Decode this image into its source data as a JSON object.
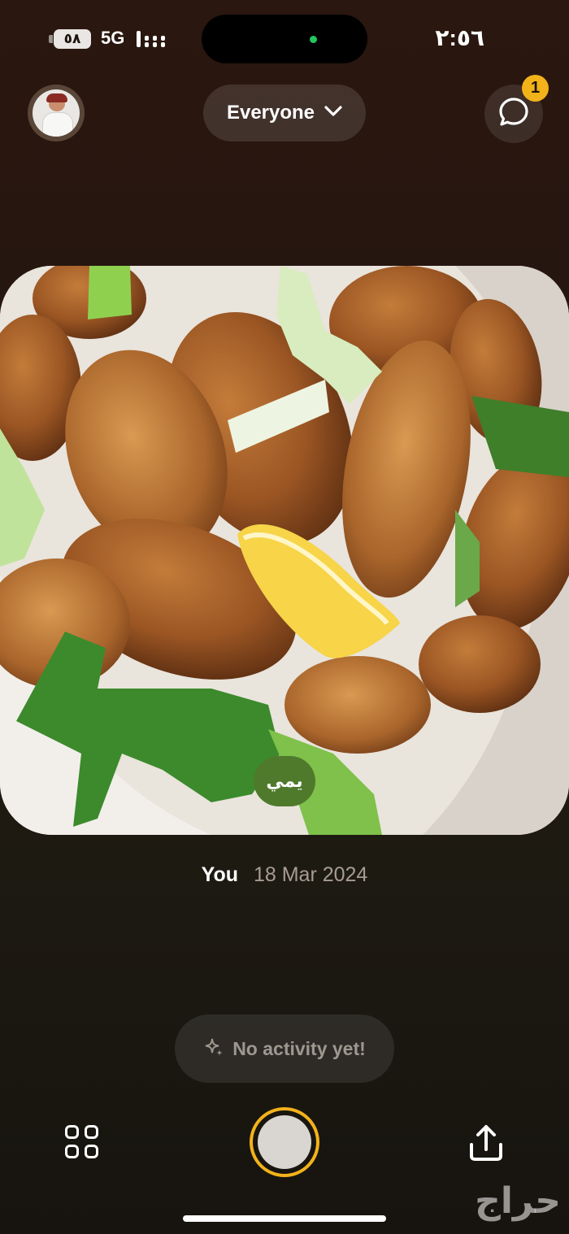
{
  "status_bar": {
    "time": "٢:٥٦",
    "battery": "٥٨",
    "network": "5G"
  },
  "top_bar": {
    "audience_label": "Everyone",
    "notification_count": "1"
  },
  "post": {
    "caption": "يمي",
    "author": "You",
    "date": "18 Mar 2024"
  },
  "activity": {
    "label": "No activity yet!"
  },
  "watermark": "حراج",
  "colors": {
    "accent": "#f2b21a",
    "caption_chip": "#4f7a2c",
    "background": "#241510"
  },
  "icons": {
    "avatar": "profile-avatar",
    "audience": "chevron-down-icon",
    "chat": "chat-bubble-icon",
    "activity": "sparkles-icon",
    "grid": "grid-icon",
    "share": "share-icon"
  }
}
